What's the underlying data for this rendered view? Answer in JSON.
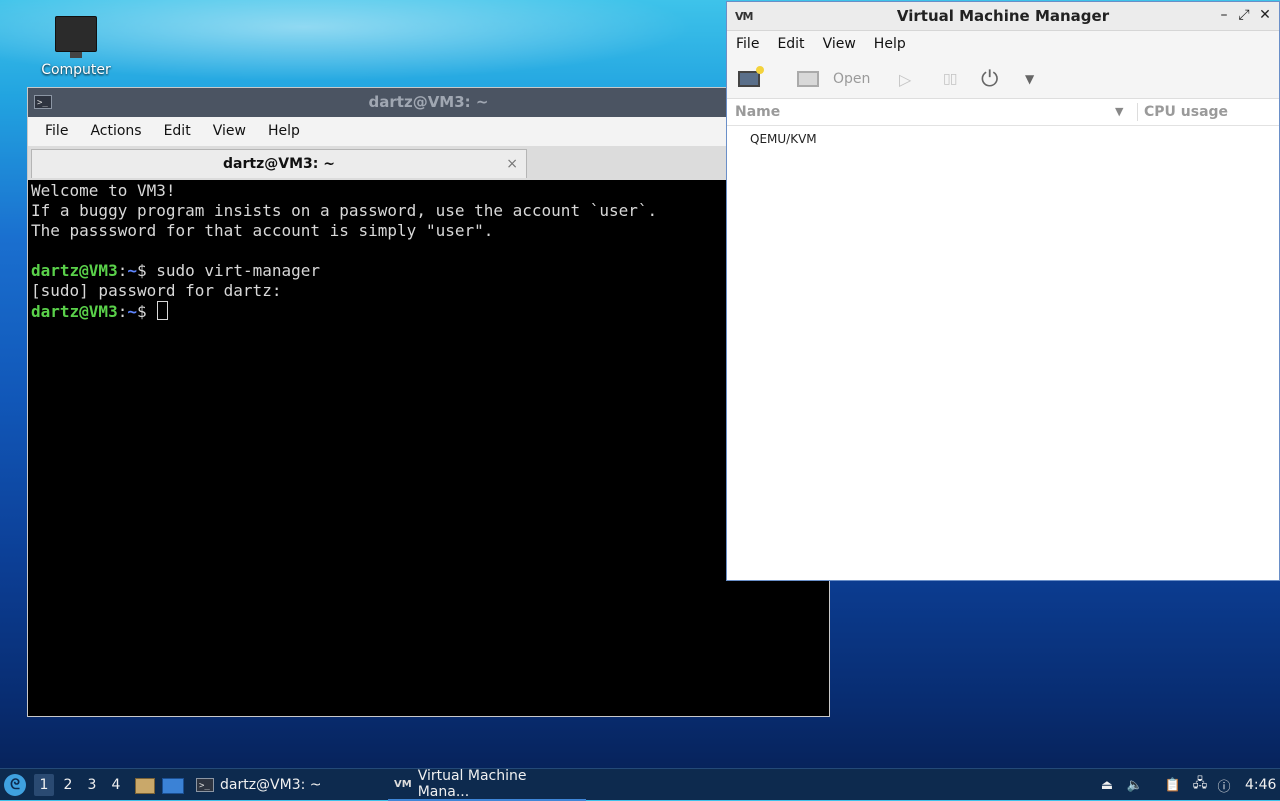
{
  "desktop": {
    "icons": [
      {
        "label": "Computer",
        "icon": "computer-icon"
      }
    ]
  },
  "terminal": {
    "title": "dartz@VM3: ~",
    "menu": [
      "File",
      "Actions",
      "Edit",
      "View",
      "Help"
    ],
    "tab_label": "dartz@VM3: ~",
    "tab_close": "×",
    "lines": {
      "l1": "Welcome to VM3!",
      "l2": "If a buggy program insists on a password, use the account `user`.",
      "l3": "The passsword for that account is simply \"user\".",
      "p1_user": "dartz@VM3",
      "p1_sep": ":",
      "p1_path": "~",
      "p1_cmd": "$ sudo virt-manager",
      "l5": "[sudo] password for dartz:",
      "p2_user": "dartz@VM3",
      "p2_sep": ":",
      "p2_path": "~",
      "p2_cmd": "$ "
    }
  },
  "vmm": {
    "title": "Virtual Machine Manager",
    "menu": [
      "File",
      "Edit",
      "View",
      "Help"
    ],
    "toolbar": {
      "open_label": "Open"
    },
    "columns": {
      "name": "Name",
      "cpu": "CPU usage"
    },
    "connections": [
      "QEMU/KVM"
    ]
  },
  "taskbar": {
    "workspaces": [
      "1",
      "2",
      "3",
      "4"
    ],
    "tasks": [
      {
        "label": "dartz@VM3: ~"
      },
      {
        "label": "Virtual Machine Mana..."
      }
    ],
    "clock": "4:46"
  }
}
